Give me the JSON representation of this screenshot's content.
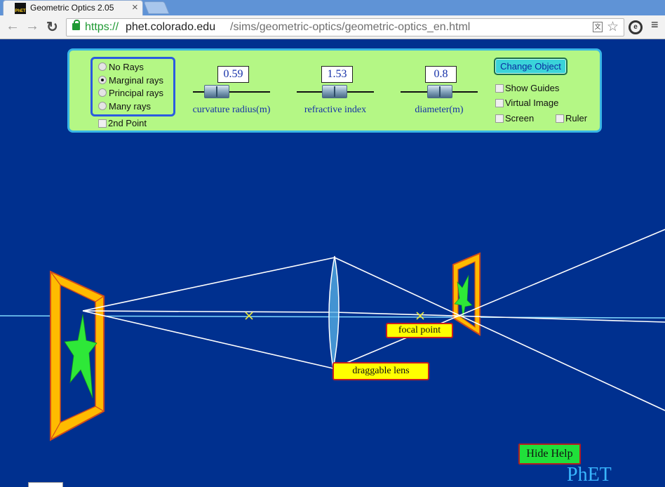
{
  "browser": {
    "tab_title": "Geometric Optics 2.05",
    "favicon_text": "PhET",
    "close_glyph": "×",
    "back_glyph": "←",
    "forward_glyph": "→",
    "reload_glyph": "↻",
    "url_scheme": "https://",
    "url_host": "phet.colorado.edu",
    "url_path": "/sims/geometric-optics/geometric-optics_en.html",
    "translate_glyph": "文",
    "star_glyph": "☆",
    "extension_glyph": "e",
    "menu_glyph": "≡"
  },
  "controls": {
    "ray_options": [
      {
        "label": "No Rays",
        "selected": false
      },
      {
        "label": "Marginal rays",
        "selected": true
      },
      {
        "label": "Principal rays",
        "selected": false
      },
      {
        "label": "Many rays",
        "selected": false
      }
    ],
    "second_point": {
      "label": "2nd Point",
      "checked": false
    },
    "sliders": [
      {
        "value": "0.59",
        "label": "curvature radius(m)"
      },
      {
        "value": "1.53",
        "label": "refractive index"
      },
      {
        "value": "0.8",
        "label": "diameter(m)"
      }
    ],
    "change_object": "Change Object",
    "checkboxes": {
      "show_guides": {
        "label": "Show Guides",
        "checked": false
      },
      "virtual_image": {
        "label": "Virtual Image",
        "checked": false
      },
      "screen": {
        "label": "Screen",
        "checked": false
      },
      "ruler": {
        "label": "Ruler",
        "checked": false
      }
    }
  },
  "scene": {
    "focal_point_label": "focal point",
    "draggable_lens_label": "draggable lens",
    "colors": {
      "background": "#00308f",
      "frame_fill": "#ffbb00",
      "frame_stroke": "#d04a1a",
      "star": "#2ee838",
      "ray": "#ffffff",
      "axis": "#7fd8ff",
      "focal_mark": "#e8e840",
      "lens": "#5ab4e8"
    }
  },
  "hide_help": "Hide Help",
  "logo": "PhET"
}
